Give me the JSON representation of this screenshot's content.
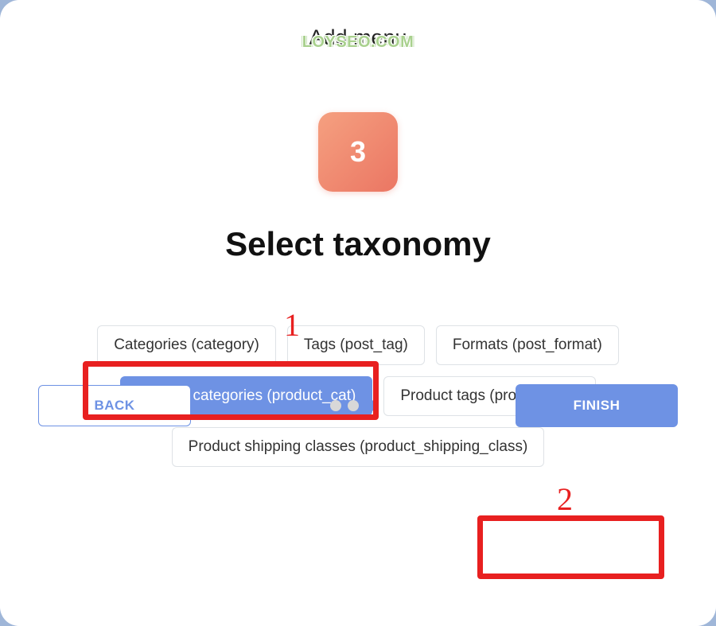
{
  "watermark": "LOYSEO.COM",
  "header": {
    "title": "Add menu"
  },
  "step": {
    "number": "3",
    "heading": "Select taxonomy"
  },
  "taxonomy": {
    "options": [
      {
        "label": "Categories (category)",
        "selected": false
      },
      {
        "label": "Tags (post_tag)",
        "selected": false
      },
      {
        "label": "Formats (post_format)",
        "selected": false
      },
      {
        "label": "Product categories (product_cat)",
        "selected": true
      },
      {
        "label": "Product tags (product_tag)",
        "selected": false
      },
      {
        "label": "Product shipping classes (product_shipping_class)",
        "selected": false
      }
    ]
  },
  "footer": {
    "back_label": "BACK",
    "finish_label": "FINISH",
    "total_steps": 3,
    "active_step": 3
  },
  "annotations": {
    "marker_1": "1",
    "marker_2": "2"
  }
}
